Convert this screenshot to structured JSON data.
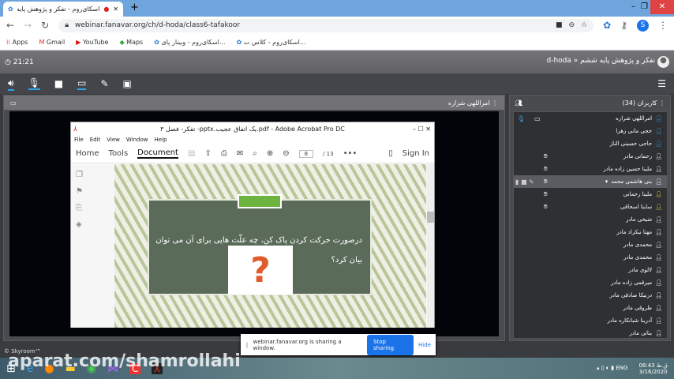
{
  "browser": {
    "tab_title": "اسکای‌روم - تفکر و پژوهش پایه",
    "url": "webinar.fanavar.org/ch/d-hoda/class6-tafakoor",
    "profile_initial": "S",
    "bookmarks": [
      "Apps",
      "Gmail",
      "YouTube",
      "Maps",
      "اسکای‌روم - وبینار پای...",
      "اسکای‌روم - کلاس ت..."
    ]
  },
  "header": {
    "timer": "21:21",
    "breadcrumb": "d-hoda » تفکر و پژوهش پایه ششم"
  },
  "stage": {
    "presenter": "امراللهی شراره"
  },
  "pdf": {
    "title": "تفکر- فصل ۳ -pptx.یک اتفاق عجیب.pdf - Adobe Acrobat Pro DC",
    "menu": [
      "File",
      "Edit",
      "View",
      "Window",
      "Help"
    ],
    "tabs": [
      "Home",
      "Tools",
      "Document"
    ],
    "page": "8",
    "total": "/ 13",
    "sign_in": "Sign In",
    "slide_text": "درصورت حرکت کردن پاک کن، چه علّت هایی برای آن می توان بیان کرد؟"
  },
  "users": {
    "title": "کاربران (34)",
    "list": [
      {
        "name": "امراللهی شراره",
        "color": "#3aa0e8",
        "mic": true,
        "screen": true
      },
      {
        "name": "حجی مانی زهرا",
        "color": "#3aa0e8"
      },
      {
        "name": "حاجی حسینی الناز",
        "color": "#3aa0e8"
      },
      {
        "name": "رحمانی مادر",
        "color": "#fff",
        "hand": true
      },
      {
        "name": "ملینا حسین زاده مادر",
        "color": "#fff",
        "hand": true
      },
      {
        "name": "بنی هاشمی محمد",
        "color": "#fff",
        "hand": true,
        "selected": true
      },
      {
        "name": "ملینا رحمانی",
        "color": "#f0d23a",
        "hand": true
      },
      {
        "name": "ساینا اسحاقی",
        "color": "#f0d23a",
        "hand": true
      },
      {
        "name": "شیخی مادر",
        "color": "#fff"
      },
      {
        "name": "مهتا نیکزاد مادر",
        "color": "#fff"
      },
      {
        "name": "محمدی مادر",
        "color": "#fff"
      },
      {
        "name": "محمدی مادر",
        "color": "#fff"
      },
      {
        "name": "لالوی مادر",
        "color": "#fff"
      },
      {
        "name": "میرقمی زاده مادر",
        "color": "#fff"
      },
      {
        "name": "درنیکا صادقی مادر",
        "color": "#fff"
      },
      {
        "name": "طروقی مادر",
        "color": "#fff"
      },
      {
        "name": "آدرینا شبانکاره مادر",
        "color": "#fff"
      },
      {
        "name": "بنائی مادر",
        "color": "#fff"
      }
    ]
  },
  "footer": {
    "copyright": "© Skyroom™"
  },
  "share": {
    "message": "webinar.fanavar.org is sharing a window.",
    "stop": "Stop sharing",
    "hide": "Hide"
  },
  "taskbar": {
    "lang": "ENG",
    "time": "08:43 ق.ظ",
    "date": "3/16/2020"
  },
  "watermark": "aparat.com/shamrollahi"
}
